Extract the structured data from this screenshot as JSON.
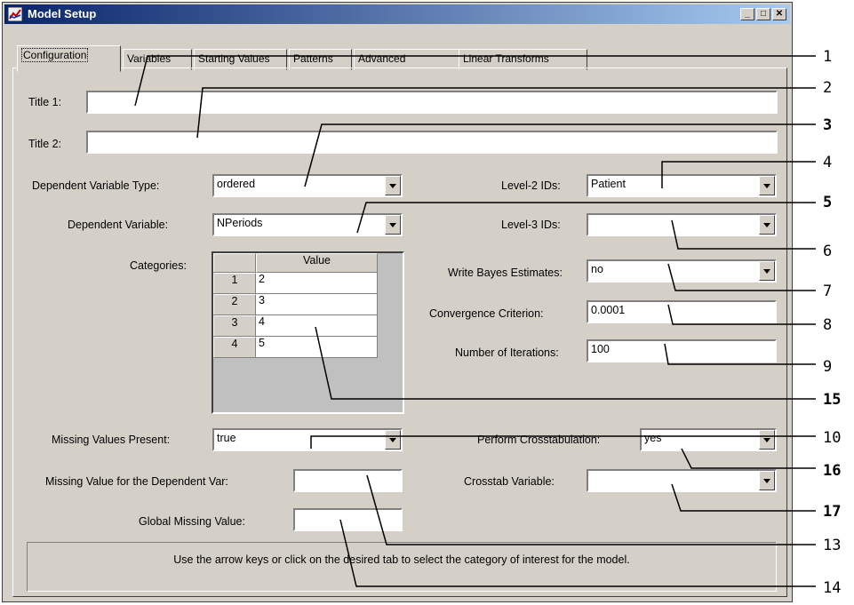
{
  "window": {
    "title": "Model Setup",
    "minimize": "_",
    "maximize": "□",
    "close": "✕"
  },
  "tabs": [
    {
      "label": "Configuration",
      "active": true
    },
    {
      "label": "Variables"
    },
    {
      "label": "Starting Values"
    },
    {
      "label": "Patterns"
    },
    {
      "label": "Advanced"
    },
    {
      "label": "Linear Transforms"
    }
  ],
  "form": {
    "title1_label": "Title 1:",
    "title1_value": "",
    "title2_label": "Title 2:",
    "title2_value": "",
    "dep_type_label": "Dependent Variable Type:",
    "dep_type_value": "ordered",
    "dep_var_label": "Dependent Variable:",
    "dep_var_value": "NPeriods",
    "categories_label": "Categories:",
    "categories_header": "Value",
    "categories": [
      {
        "row": "1",
        "value": "2"
      },
      {
        "row": "2",
        "value": "3"
      },
      {
        "row": "3",
        "value": "4"
      },
      {
        "row": "4",
        "value": "5"
      }
    ],
    "level2_label": "Level-2 IDs:",
    "level2_value": "Patient",
    "level3_label": "Level-3 IDs:",
    "level3_value": "",
    "bayes_label": "Write Bayes Estimates:",
    "bayes_value": "no",
    "conv_label": "Convergence Criterion:",
    "conv_value": "0.0001",
    "iter_label": "Number of Iterations:",
    "iter_value": "100",
    "missing_present_label": "Missing Values Present:",
    "missing_present_value": "true",
    "missing_dep_label": "Missing Value for the Dependent Var:",
    "missing_dep_value": "",
    "global_missing_label": "Global Missing Value:",
    "global_missing_value": "",
    "crosstab_label": "Perform Crosstabulation:",
    "crosstab_value": "yes",
    "crosstab_var_label": "Crosstab Variable:",
    "crosstab_var_value": ""
  },
  "status": "Use the arrow keys or click on the desired tab to select the category of interest for the model.",
  "callouts": [
    "1",
    "2",
    "3",
    "4",
    "5",
    "6",
    "7",
    "8",
    "9",
    "15",
    "10",
    "16",
    "17",
    "13",
    "14"
  ]
}
